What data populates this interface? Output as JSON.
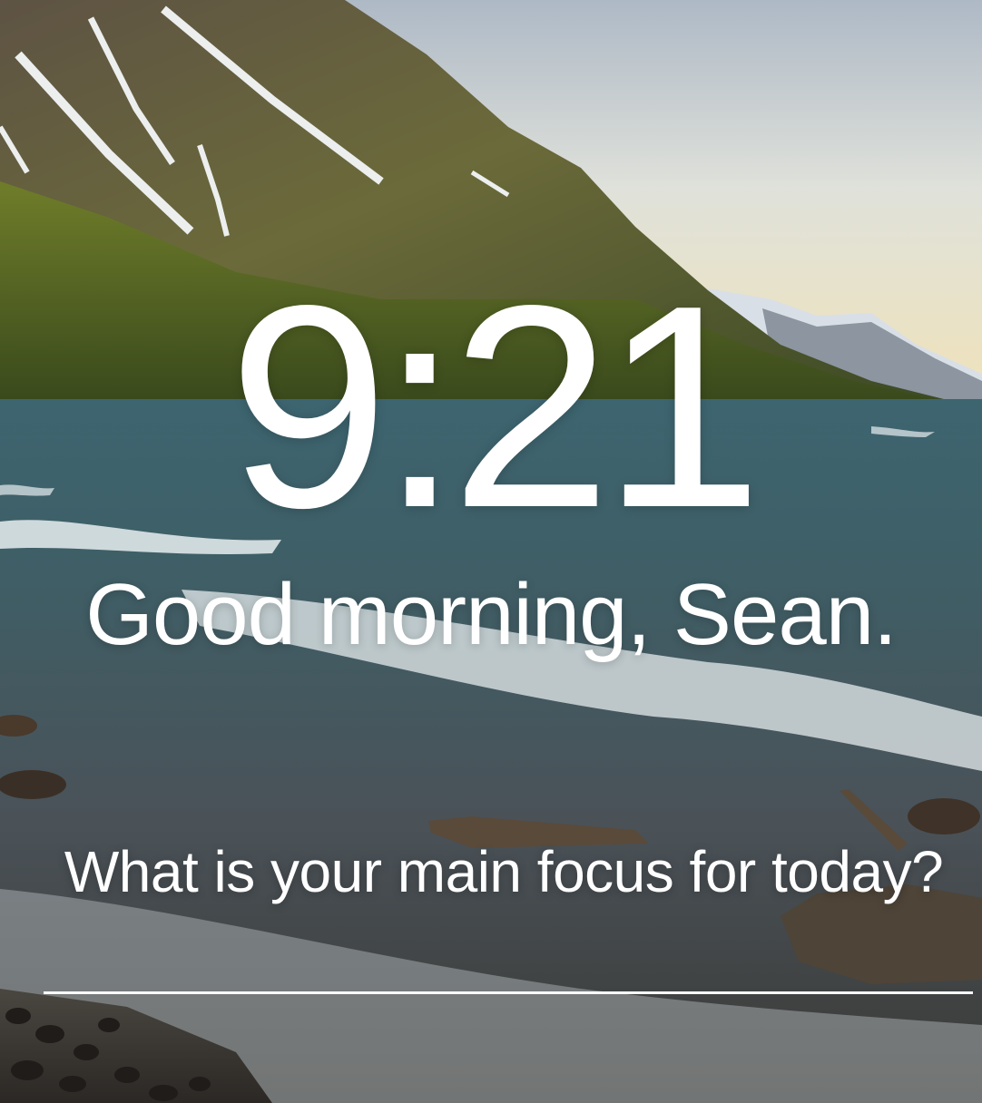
{
  "background": {
    "scene": "mountain lake with waves at sunrise"
  },
  "clock": {
    "time": "9:21"
  },
  "greeting": {
    "text": "Good morning, Sean."
  },
  "focus": {
    "prompt": "What is your main focus for today?",
    "value": ""
  }
}
